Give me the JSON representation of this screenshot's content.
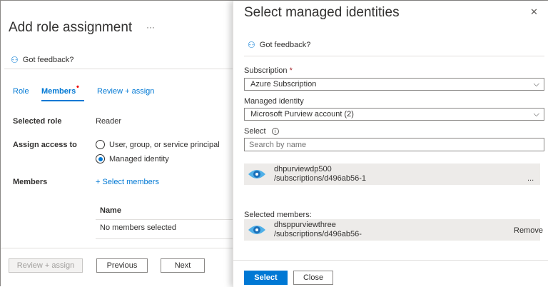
{
  "left": {
    "title": "Add role assignment",
    "more": "···",
    "feedback": "Got feedback?",
    "tabs": [
      "Role",
      "Members",
      "Review + assign"
    ],
    "selected_role_label": "Selected role",
    "selected_role_value": "Reader",
    "assign_label": "Assign access to",
    "radio_options": [
      "User, group, or service principal",
      "Managed identity"
    ],
    "members_label": "Members",
    "select_members": "+ Select members",
    "table_header": "Name",
    "empty_text": "No members selected",
    "buttons": {
      "review": "Review + assign",
      "previous": "Previous",
      "next": "Next"
    }
  },
  "panel": {
    "title": "Select managed identities",
    "close": "✕",
    "feedback": "Got feedback?",
    "subscription_label": "Subscription",
    "required": "*",
    "subscription_value": "Azure Subscription",
    "identity_label": "Managed identity",
    "identity_value": "Microsoft Purview account (2)",
    "select_label": "Select",
    "info": "i",
    "search_placeholder": "Search by name",
    "results": [
      {
        "name": "dhpurviewdp500",
        "path": "/subscriptions/d496ab56-1",
        "trail": "..."
      }
    ],
    "selected_label": "Selected members:",
    "selected": [
      {
        "name": "dhsppurviewthree",
        "path": "/subscriptions/d496ab56-",
        "action": "Remove"
      }
    ],
    "buttons": {
      "select": "Select",
      "close": "Close"
    }
  }
}
